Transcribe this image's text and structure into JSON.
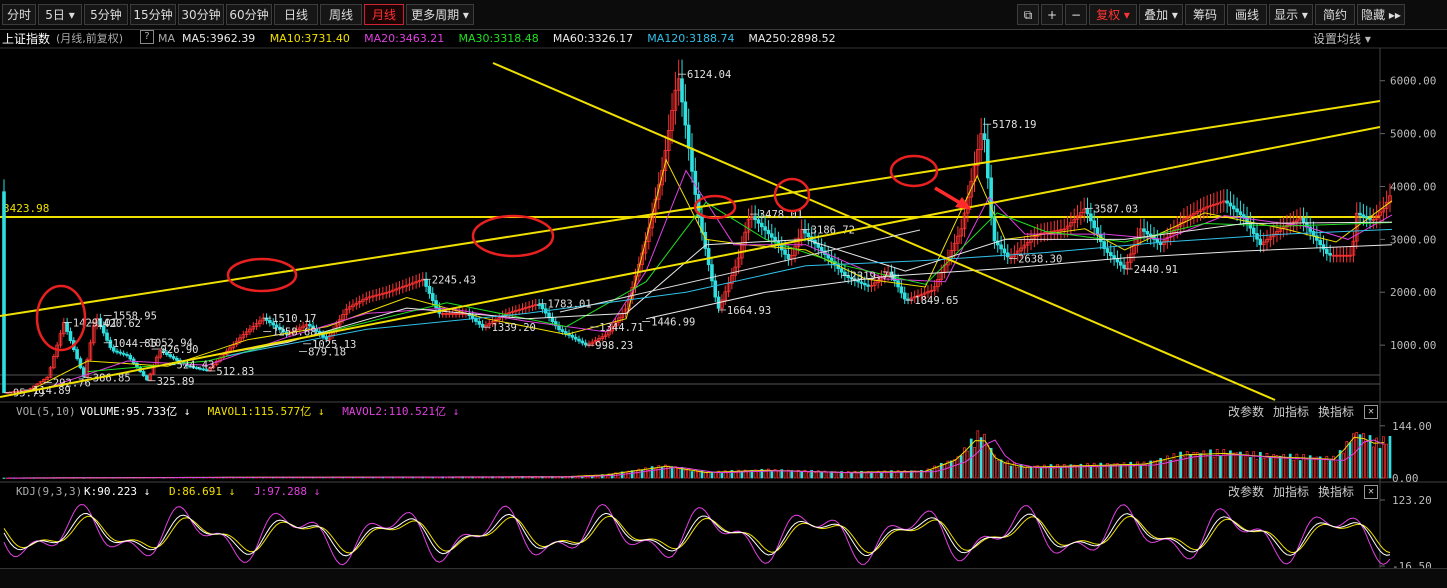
{
  "toolbar": {
    "left": [
      {
        "label": "分时"
      },
      {
        "label": "5日 ▾"
      },
      {
        "label": "5分钟"
      },
      {
        "label": "15分钟"
      },
      {
        "label": "30分钟"
      },
      {
        "label": "60分钟"
      },
      {
        "label": "日线"
      },
      {
        "label": "周线"
      },
      {
        "label": "月线",
        "active": true
      },
      {
        "label": "更多周期 ▾"
      }
    ],
    "right": [
      {
        "label": "⧉"
      },
      {
        "label": "+"
      },
      {
        "label": "−"
      },
      {
        "label": "复权 ▾",
        "red": true
      },
      {
        "label": "叠加 ▾"
      },
      {
        "label": "筹码"
      },
      {
        "label": "画线"
      },
      {
        "label": "显示 ▾"
      },
      {
        "label": "简约"
      },
      {
        "label": "隐藏 ▸▸"
      }
    ]
  },
  "info": {
    "title": "上证指数",
    "mode": "(月线,前复权)",
    "qmark": "?",
    "ma_label": "MA",
    "ma": [
      {
        "text": "MA5:3962.39",
        "color": "#e8e8e8"
      },
      {
        "text": "MA10:3731.40",
        "color": "#f0e000"
      },
      {
        "text": "MA20:3463.21",
        "color": "#e040e0"
      },
      {
        "text": "MA30:3318.48",
        "color": "#20e020"
      },
      {
        "text": "MA60:3326.17",
        "color": "#e8e8e8"
      },
      {
        "text": "MA120:3188.74",
        "color": "#30c0e8"
      },
      {
        "text": "MA250:2898.52",
        "color": "#e8e8e8"
      }
    ],
    "settings": "设置均线 ▾"
  },
  "chart_data": [
    {
      "type": "line",
      "title": "上证指数",
      "ylim": [
        0,
        6600
      ],
      "yticks": [
        "6000.00",
        "5000.00",
        "4000.00",
        "3000.00",
        "2000.00",
        "1000.00"
      ],
      "ytick_values": [
        6000,
        5000,
        4000,
        3000,
        2000,
        1000
      ],
      "xticks": [
        "1995",
        "2000",
        "2005",
        "2010",
        "2015",
        "2020",
        "2025"
      ],
      "xtick_values": [
        1995,
        2000,
        2005,
        2010,
        2015,
        2020,
        2025
      ],
      "xlim": [
        1990.8,
        2025.4
      ],
      "series": [
        {
          "values": [
            [
              1990.9,
              100
            ],
            [
              1991.5,
              150
            ],
            [
              1992.0,
              400
            ],
            [
              1992.4,
              1429
            ],
            [
              1992.9,
              400
            ],
            [
              1993.2,
              1558
            ],
            [
              1993.6,
              900
            ],
            [
              1994.0,
              800
            ],
            [
              1994.5,
              326
            ],
            [
              1994.8,
              900
            ],
            [
              1995.5,
              600
            ],
            [
              1996.0,
              520
            ],
            [
              1996.9,
              1200
            ],
            [
              1997.4,
              1510
            ],
            [
              1998.0,
              1200
            ],
            [
              1998.5,
              1400
            ],
            [
              1999.0,
              1100
            ],
            [
              1999.5,
              1700
            ],
            [
              2000.0,
              1900
            ],
            [
              2000.5,
              2000
            ],
            [
              2001.4,
              2245
            ],
            [
              2001.8,
              1600
            ],
            [
              2002.5,
              1600
            ],
            [
              2002.9,
              1340
            ],
            [
              2003.5,
              1600
            ],
            [
              2004.3,
              1783
            ],
            [
              2004.8,
              1300
            ],
            [
              2005.5,
              998
            ],
            [
              2006.0,
              1200
            ],
            [
              2006.5,
              1700
            ],
            [
              2007.0,
              3000
            ],
            [
              2007.4,
              4300
            ],
            [
              2007.8,
              6124
            ],
            [
              2008.3,
              3500
            ],
            [
              2008.8,
              1665
            ],
            [
              2009.3,
              2600
            ],
            [
              2009.6,
              3478
            ],
            [
              2010.2,
              3000
            ],
            [
              2010.6,
              2600
            ],
            [
              2010.9,
              3186
            ],
            [
              2011.5,
              2700
            ],
            [
              2012.0,
              2300
            ],
            [
              2012.6,
              2100
            ],
            [
              2013.1,
              2400
            ],
            [
              2013.5,
              1849
            ],
            [
              2014.2,
              2050
            ],
            [
              2014.9,
              3200
            ],
            [
              2015.45,
              5178
            ],
            [
              2015.7,
              3000
            ],
            [
              2016.1,
              2638
            ],
            [
              2016.8,
              3100
            ],
            [
              2017.5,
              3200
            ],
            [
              2018.0,
              3587
            ],
            [
              2018.5,
              2800
            ],
            [
              2019.0,
              2440
            ],
            [
              2019.4,
              3200
            ],
            [
              2019.9,
              2900
            ],
            [
              2020.5,
              3400
            ],
            [
              2021.0,
              3600
            ],
            [
              2021.5,
              3731
            ],
            [
              2022.0,
              3400
            ],
            [
              2022.4,
              2900
            ],
            [
              2022.9,
              3200
            ],
            [
              2023.4,
              3400
            ],
            [
              2023.8,
              3000
            ],
            [
              2024.1,
              2700
            ],
            [
              2024.7,
              2700
            ],
            [
              2024.8,
              3500
            ],
            [
              2025.2,
              3350
            ],
            [
              2025.5,
              3600
            ],
            [
              2025.7,
              3900
            ]
          ]
        },
        {
          "values": [
            [
              1991.5,
              120
            ],
            [
              1993.0,
              700
            ],
            [
              1995.0,
              600
            ],
            [
              1997.0,
              1100
            ],
            [
              1999.0,
              1350
            ],
            [
              2001.0,
              1900
            ],
            [
              2003.0,
              1500
            ],
            [
              2005.0,
              1200
            ],
            [
              2006.5,
              1500
            ],
            [
              2007.5,
              4500
            ],
            [
              2008.5,
              3000
            ],
            [
              2009.5,
              2900
            ],
            [
              2011.0,
              2800
            ],
            [
              2012.5,
              2250
            ],
            [
              2014.0,
              2100
            ],
            [
              2015.3,
              4200
            ],
            [
              2016.0,
              3000
            ],
            [
              2018.0,
              3200
            ],
            [
              2019.0,
              2800
            ],
            [
              2021.0,
              3500
            ],
            [
              2023.0,
              3200
            ],
            [
              2024.3,
              2950
            ],
            [
              2025.7,
              3730
            ]
          ]
        },
        {
          "values": [
            [
              1992.0,
              200
            ],
            [
              1994.0,
              700
            ],
            [
              1996.0,
              620
            ],
            [
              1998.0,
              1150
            ],
            [
              2000.0,
              1600
            ],
            [
              2002.0,
              1700
            ],
            [
              2004.0,
              1450
            ],
            [
              2006.0,
              1250
            ],
            [
              2007.0,
              2400
            ],
            [
              2008.0,
              4300
            ],
            [
              2009.2,
              2900
            ],
            [
              2011.0,
              2900
            ],
            [
              2013.0,
              2250
            ],
            [
              2014.5,
              2200
            ],
            [
              2015.6,
              3800
            ],
            [
              2016.5,
              3100
            ],
            [
              2018.5,
              3100
            ],
            [
              2020.0,
              3000
            ],
            [
              2021.5,
              3450
            ],
            [
              2023.5,
              3250
            ],
            [
              2024.6,
              3000
            ],
            [
              2025.7,
              3463
            ]
          ]
        },
        {
          "values": [
            [
              1993.0,
              500
            ],
            [
              1996.0,
              700
            ],
            [
              1999.0,
              1250
            ],
            [
              2002.0,
              1800
            ],
            [
              2005.0,
              1350
            ],
            [
              2007.0,
              2200
            ],
            [
              2008.5,
              3700
            ],
            [
              2010.0,
              3000
            ],
            [
              2012.0,
              2500
            ],
            [
              2014.0,
              2150
            ],
            [
              2015.8,
              3500
            ],
            [
              2017.0,
              3150
            ],
            [
              2019.0,
              2950
            ],
            [
              2021.0,
              3300
            ],
            [
              2023.0,
              3250
            ],
            [
              2025.7,
              3318
            ]
          ]
        },
        {
          "values": [
            [
              1995.0,
              650
            ],
            [
              1998.0,
              1050
            ],
            [
              2001.0,
              1700
            ],
            [
              2004.0,
              1500
            ],
            [
              2006.5,
              1600
            ],
            [
              2008.5,
              2900
            ],
            [
              2011.0,
              3000
            ],
            [
              2013.5,
              2400
            ],
            [
              2016.0,
              3000
            ],
            [
              2019.0,
              3000
            ],
            [
              2022.0,
              3300
            ],
            [
              2025.7,
              3326
            ]
          ]
        },
        {
          "values": [
            [
              1996.5,
              800
            ],
            [
              2000.0,
              1300
            ],
            [
              2004.0,
              1600
            ],
            [
              2008.0,
              2000
            ],
            [
              2011.0,
              2500
            ],
            [
              2014.0,
              2600
            ],
            [
              2017.0,
              2750
            ],
            [
              2020.0,
              2950
            ],
            [
              2023.0,
              3100
            ],
            [
              2025.7,
              3189
            ]
          ]
        },
        {
          "values": [
            [
              2007.0,
              1500
            ],
            [
              2010.0,
              2000
            ],
            [
              2013.0,
              2300
            ],
            [
              2016.0,
              2450
            ],
            [
              2019.0,
              2650
            ],
            [
              2022.0,
              2780
            ],
            [
              2025.7,
              2899
            ]
          ]
        }
      ],
      "annotations": [
        {
          "x": 2007.8,
          "y": 6124,
          "text": "6124.04"
        },
        {
          "x": 2015.45,
          "y": 5178,
          "text": "5178.19"
        },
        {
          "x": 2009.6,
          "y": 3478,
          "text": "3478.01"
        },
        {
          "x": 2010.9,
          "y": 3186,
          "text": "3186.72"
        },
        {
          "x": 2018.0,
          "y": 3587,
          "text": "3587.03"
        },
        {
          "x": 2001.4,
          "y": 2245,
          "text": "2245.43"
        },
        {
          "x": 2004.3,
          "y": 1783,
          "text": "1783.01"
        },
        {
          "x": 2008.8,
          "y": 1665,
          "text": "1664.93"
        },
        {
          "x": 2016.1,
          "y": 2638,
          "text": "2638.30"
        },
        {
          "x": 2019.0,
          "y": 2440,
          "text": "2440.91"
        },
        {
          "x": 2013.5,
          "y": 1849,
          "text": "1849.65"
        },
        {
          "x": 2011.9,
          "y": 2319,
          "text": "2319.74"
        },
        {
          "x": 2005.5,
          "y": 998,
          "text": "998.23"
        },
        {
          "x": 2006.9,
          "y": 1446,
          "text": "1446.99"
        },
        {
          "x": 2005.6,
          "y": 1344,
          "text": "1344.71"
        },
        {
          "x": 2002.9,
          "y": 1339,
          "text": "1339.20"
        },
        {
          "x": 1997.4,
          "y": 1510,
          "text": "1510.17"
        },
        {
          "x": 1997.4,
          "y": 1258,
          "text": "1258.68"
        },
        {
          "x": 1998.4,
          "y": 1025,
          "text": "1025.13"
        },
        {
          "x": 1998.3,
          "y": 879,
          "text": "879.18"
        },
        {
          "x": 1994.6,
          "y": 926,
          "text": "926.90"
        },
        {
          "x": 1994.3,
          "y": 1052,
          "text": "1052.94"
        },
        {
          "x": 1993.4,
          "y": 1044,
          "text": "1044.85"
        },
        {
          "x": 1993.4,
          "y": 1558,
          "text": "1558.95"
        },
        {
          "x": 1992.4,
          "y": 1429,
          "text": "1429.01"
        },
        {
          "x": 1993.0,
          "y": 1420,
          "text": "1420.62"
        },
        {
          "x": 1996.0,
          "y": 512,
          "text": "512.83"
        },
        {
          "x": 1995.0,
          "y": 630,
          "text": "524.43"
        },
        {
          "x": 1994.5,
          "y": 326,
          "text": "325.89"
        },
        {
          "x": 1992.9,
          "y": 387,
          "text": "386.85"
        },
        {
          "x": 1991.9,
          "y": 292,
          "text": "292.76"
        },
        {
          "x": 1991.4,
          "y": 150,
          "text": "114.89"
        },
        {
          "x": 1990.9,
          "y": 100,
          "text": "95.79"
        }
      ],
      "reference_line": {
        "y": 3423.98,
        "text": "3423.98"
      }
    },
    {
      "type": "bar",
      "title": "VOL(5,10)",
      "ylim": [
        0,
        160
      ],
      "yticks": [
        "144.00",
        "0.00"
      ],
      "ytick_values": [
        144,
        0
      ],
      "values_note": "monthly volume (亿)",
      "xlim": [
        1990.8,
        2025.4
      ],
      "envelope": [
        [
          1990.9,
          0
        ],
        [
          1996.0,
          2
        ],
        [
          2000.0,
          3
        ],
        [
          2005.0,
          4
        ],
        [
          2006.0,
          10
        ],
        [
          2007.5,
          38
        ],
        [
          2008.5,
          18
        ],
        [
          2010.0,
          25
        ],
        [
          2012.0,
          18
        ],
        [
          2014.0,
          22
        ],
        [
          2014.8,
          60
        ],
        [
          2015.4,
          142
        ],
        [
          2015.8,
          55
        ],
        [
          2016.5,
          35
        ],
        [
          2018.0,
          40
        ],
        [
          2019.5,
          45
        ],
        [
          2020.5,
          75
        ],
        [
          2021.5,
          80
        ],
        [
          2022.5,
          70
        ],
        [
          2023.5,
          65
        ],
        [
          2024.3,
          60
        ],
        [
          2024.8,
          140
        ],
        [
          2025.3,
          110
        ],
        [
          2025.7,
          120
        ]
      ]
    },
    {
      "type": "line",
      "title": "KDJ(9,3,3)",
      "ylim": [
        -16.5,
        123.2
      ],
      "yticks": [
        "123.20",
        "-16.50"
      ],
      "ytick_values": [
        123.2,
        -16.5
      ],
      "xlim": [
        1990.8,
        2025.4
      ]
    }
  ],
  "volume_bar": {
    "label": "VOL(5,10)",
    "items": [
      {
        "text": "VOLUME:95.733亿 ↓",
        "color": "#ffffff"
      },
      {
        "text": "MAVOL1:115.577亿 ↓",
        "color": "#f0e000"
      },
      {
        "text": "MAVOL2:110.521亿 ↓",
        "color": "#e040e0"
      }
    ],
    "btn1": "改参数",
    "btn2": "加指标",
    "btn3": "换指标",
    "close": "✕"
  },
  "kdj_bar": {
    "label": "KDJ(9,3,3)",
    "items": [
      {
        "text": "K:90.223 ↓",
        "color": "#ffffff"
      },
      {
        "text": "D:86.691 ↓",
        "color": "#f0e000"
      },
      {
        "text": "J:97.288 ↓",
        "color": "#e040e0"
      }
    ],
    "btn1": "改参数",
    "btn2": "加指标",
    "btn3": "换指标",
    "close": "✕"
  },
  "colors": {
    "accent": "#ff3333",
    "trendline": "#f0e000",
    "circle": "#e82020",
    "up": "#ff3333",
    "down": "#30e0e0"
  }
}
